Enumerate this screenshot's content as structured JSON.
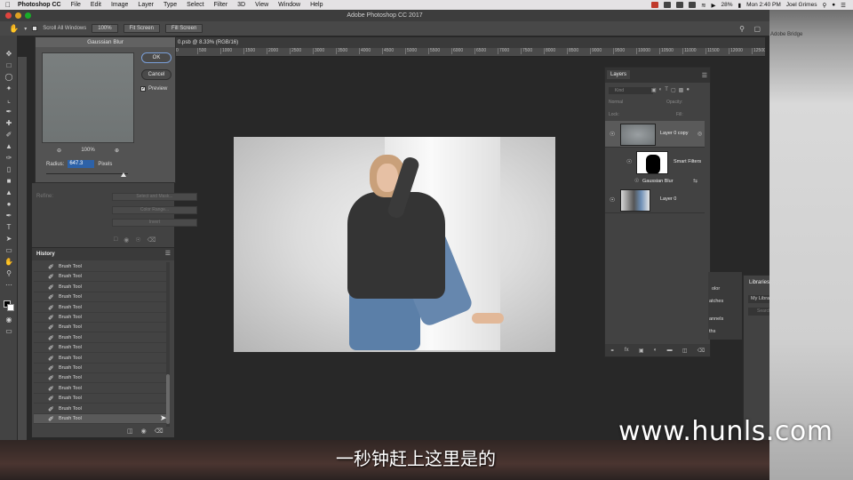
{
  "menubar": {
    "app": "Photoshop CC",
    "items": [
      "File",
      "Edit",
      "Image",
      "Layer",
      "Type",
      "Select",
      "Filter",
      "3D",
      "View",
      "Window",
      "Help"
    ],
    "battery": "28%",
    "time": "Mon 2:40 PM",
    "user": "Joel Grimes"
  },
  "window": {
    "title": "Adobe Photoshop CC 2017"
  },
  "options": {
    "scroll_all": "Scroll All Windows",
    "zoom": "100%",
    "fit": "Fit Screen",
    "fill": "Fill Screen"
  },
  "document": {
    "tab": "0.psb @ 8.33% (RGB/16)",
    "ruler": [
      "0",
      "500",
      "1000",
      "1500",
      "2000",
      "2500",
      "3000",
      "3500",
      "4000",
      "4500",
      "5000",
      "5500",
      "6000",
      "6500",
      "7000",
      "7500",
      "8000",
      "8500",
      "9000",
      "9500",
      "10000",
      "10500",
      "11000",
      "11500",
      "12000",
      "12500"
    ]
  },
  "gaussian": {
    "title": "Gaussian Blur",
    "ok": "OK",
    "cancel": "Cancel",
    "preview": "Preview",
    "zoom": "100%",
    "radius_label": "Radius:",
    "radius": "647.3",
    "unit": "Pixels"
  },
  "props": {
    "refine": "Refine:",
    "select_mask": "Select and Mask...",
    "color_range": "Color Range...",
    "invert": "Invert"
  },
  "history": {
    "title": "History",
    "items": [
      "Brush Tool",
      "Brush Tool",
      "Brush Tool",
      "Brush Tool",
      "Brush Tool",
      "Brush Tool",
      "Brush Tool",
      "Brush Tool",
      "Brush Tool",
      "Brush Tool",
      "Brush Tool",
      "Brush Tool",
      "Brush Tool",
      "Brush Tool",
      "Brush Tool",
      "Brush Tool"
    ]
  },
  "layers": {
    "tab": "Layers",
    "kind": "Kind",
    "blend": "Normal",
    "opacity": "Opacity:",
    "lock": "Lock:",
    "fill": "Fill:",
    "rows": [
      {
        "name": "Layer 0 copy"
      },
      {
        "name": "Smart Filters"
      },
      {
        "name": "Gaussian Blur"
      },
      {
        "name": "Layer 0"
      }
    ]
  },
  "libraries": {
    "tab": "Libraries",
    "library": "My Library",
    "search": "Search Adobe Stock"
  },
  "sidepeek": {
    "items": [
      "olor",
      "atches",
      "annels",
      "ths"
    ]
  },
  "desktop": {
    "bridge": "Adobe Bridge"
  },
  "watermark": "www.hunls.com",
  "subtitle": "一秒钟赶上这里是的",
  "colors": {
    "selection": "#2d62a8",
    "panel": "#424242"
  }
}
